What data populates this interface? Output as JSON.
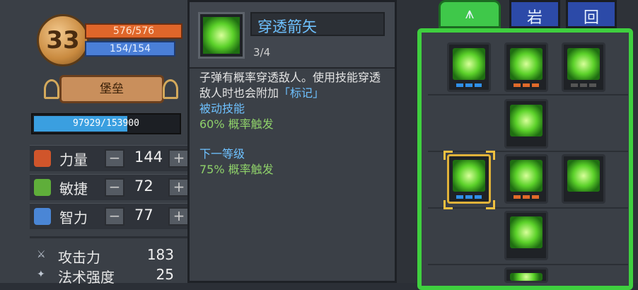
{
  "character": {
    "level": "33",
    "hp": "576/576",
    "mp": "154/154",
    "class_name": "堡垒",
    "xp_text": "97929/153900",
    "xp_fraction": 0.636
  },
  "stats": [
    {
      "label": "力量",
      "value": "144",
      "minus": "−",
      "plus": "+",
      "icon_color": "#d0552b",
      "icon": "fist-icon"
    },
    {
      "label": "敏捷",
      "value": "72",
      "minus": "−",
      "plus": "+",
      "icon_color": "#5fae3a",
      "icon": "feather-icon"
    },
    {
      "label": "智力",
      "value": "77",
      "minus": "−",
      "plus": "+",
      "icon_color": "#4a86d6",
      "icon": "book-icon"
    }
  ],
  "attributes": [
    {
      "label": "攻击力",
      "value": "183",
      "icon": "sword-icon"
    },
    {
      "label": "法术强度",
      "value": "25",
      "icon": "wand-icon"
    }
  ],
  "tooltip": {
    "title": "穿透箭矢",
    "level": "3/4",
    "desc_part1": "子弹有概率穿透敌人。使用技能穿透敌人时也会附加",
    "desc_highlight": "「标记」",
    "passive_label": "被动技能",
    "current_effect": "60% 概率触发",
    "next_label": "下一等级",
    "next_effect": "75% 概率触发"
  },
  "tabs": {
    "bow_tab": "bow-icon",
    "tab2_glyph": "岩",
    "tab3_glyph": "回"
  },
  "colors": {
    "frame_green": "#3fcf3f",
    "pip_blue": "#2f8fe8",
    "pip_orange": "#e06a2a",
    "title_blue": "#6ec1ff",
    "effect_green": "#8fd16a"
  }
}
